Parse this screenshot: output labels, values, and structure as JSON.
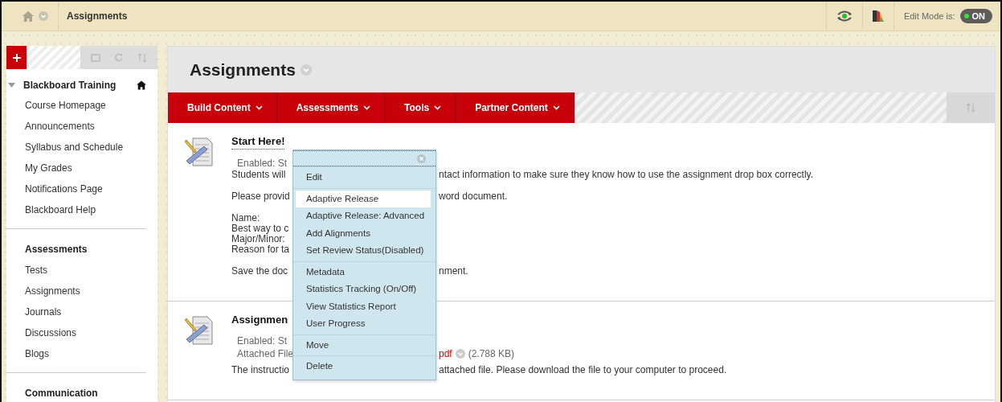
{
  "breadcrumb": {
    "label": "Assignments"
  },
  "topbar": {
    "edit_mode_label": "Edit Mode is:",
    "edit_mode": {
      "label": "ON",
      "on": true
    }
  },
  "sidebar": {
    "course": {
      "title": "Blackboard Training",
      "expanded": true,
      "items": [
        "Course Homepage",
        "Announcements",
        "Syllabus and Schedule",
        "My Grades",
        "Notifications Page",
        "Blackboard Help"
      ]
    },
    "sections": [
      {
        "title": "Assessments",
        "items": [
          "Tests",
          "Assignments",
          "Journals",
          "Discussions",
          "Blogs"
        ]
      },
      {
        "title": "Communication"
      }
    ]
  },
  "page": {
    "title": "Assignments"
  },
  "action_bar": [
    {
      "label": "Build Content"
    },
    {
      "label": "Assessments"
    },
    {
      "label": "Tools"
    },
    {
      "label": "Partner Content"
    }
  ],
  "content_items": [
    {
      "title": "Start Here!",
      "details": [
        {
          "left": "Enabled:  St"
        }
      ],
      "paragraphs": [
        [
          {
            "left": "Students will",
            "right": "ntact information to make sure they know how to use the assignment drop box correctly."
          }
        ],
        [
          {
            "left": "Please provid",
            "right": "word document."
          }
        ],
        [
          {
            "left": "Name:"
          },
          {
            "left": "Best way to c"
          },
          {
            "left": "Major/Minor:"
          },
          {
            "left": "Reason for ta"
          }
        ],
        [
          {
            "left": "Save the doc",
            "right": "nment."
          }
        ]
      ]
    },
    {
      "title": "Assignmen",
      "details": [
        {
          "left": "Enabled:  St"
        },
        {
          "left": "Attached File",
          "link": "pdf",
          "size": "(2.788 KB)"
        }
      ],
      "paragraphs": [
        [
          {
            "left": "The instructio",
            "right": "attached file.  Please download the file to your computer to proceed."
          }
        ]
      ]
    }
  ],
  "context_menu": {
    "groups": [
      [
        {
          "label": "Edit",
          "selected": false
        }
      ],
      [
        {
          "label": "Adaptive Release",
          "selected": true
        },
        {
          "label": "Adaptive Release: Advanced",
          "selected": false
        },
        {
          "label": "Add Alignments",
          "selected": false
        },
        {
          "label": "Set Review Status(Disabled)",
          "selected": false
        }
      ],
      [
        {
          "label": "Metadata",
          "selected": false
        },
        {
          "label": "Statistics Tracking (On/Off)",
          "selected": false
        },
        {
          "label": "View Statistics Report",
          "selected": false
        },
        {
          "label": "User Progress",
          "selected": false
        }
      ],
      [
        {
          "label": "Move",
          "selected": false
        }
      ],
      [
        {
          "label": "Delete",
          "selected": false
        }
      ]
    ]
  }
}
